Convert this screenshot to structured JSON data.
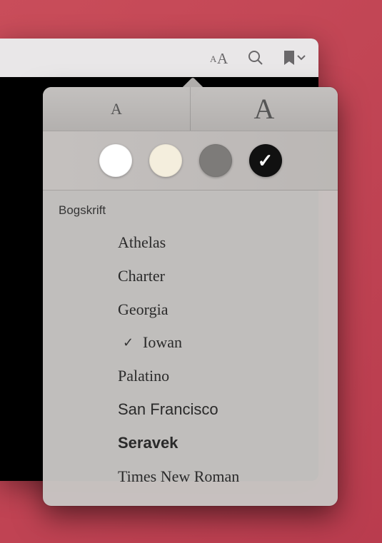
{
  "toolbar": {
    "appearance_icon": "appearance-icon",
    "search_icon": "search-icon",
    "bookmark_icon": "bookmark-icon"
  },
  "popover": {
    "size_small_label": "A",
    "size_large_label": "A",
    "themes": [
      {
        "name": "white",
        "color": "#ffffff",
        "selected": false
      },
      {
        "name": "sepia",
        "color": "#f4eedd",
        "selected": false
      },
      {
        "name": "gray",
        "color": "#7d7b79",
        "selected": false
      },
      {
        "name": "black",
        "color": "#111111",
        "selected": true
      }
    ],
    "font_header": "Bogskrift",
    "fonts": [
      {
        "label": "Athelas",
        "class": "f-athelas",
        "selected": false
      },
      {
        "label": "Charter",
        "class": "f-charter",
        "selected": false
      },
      {
        "label": "Georgia",
        "class": "f-georgia",
        "selected": false
      },
      {
        "label": "Iowan",
        "class": "f-iowan",
        "selected": true
      },
      {
        "label": "Palatino",
        "class": "f-palatino",
        "selected": false
      },
      {
        "label": "San Francisco",
        "class": "f-sanfran",
        "selected": false
      },
      {
        "label": "Seravek",
        "class": "f-seravek",
        "selected": false
      },
      {
        "label": "Times New Roman",
        "class": "f-times",
        "selected": false
      }
    ]
  }
}
